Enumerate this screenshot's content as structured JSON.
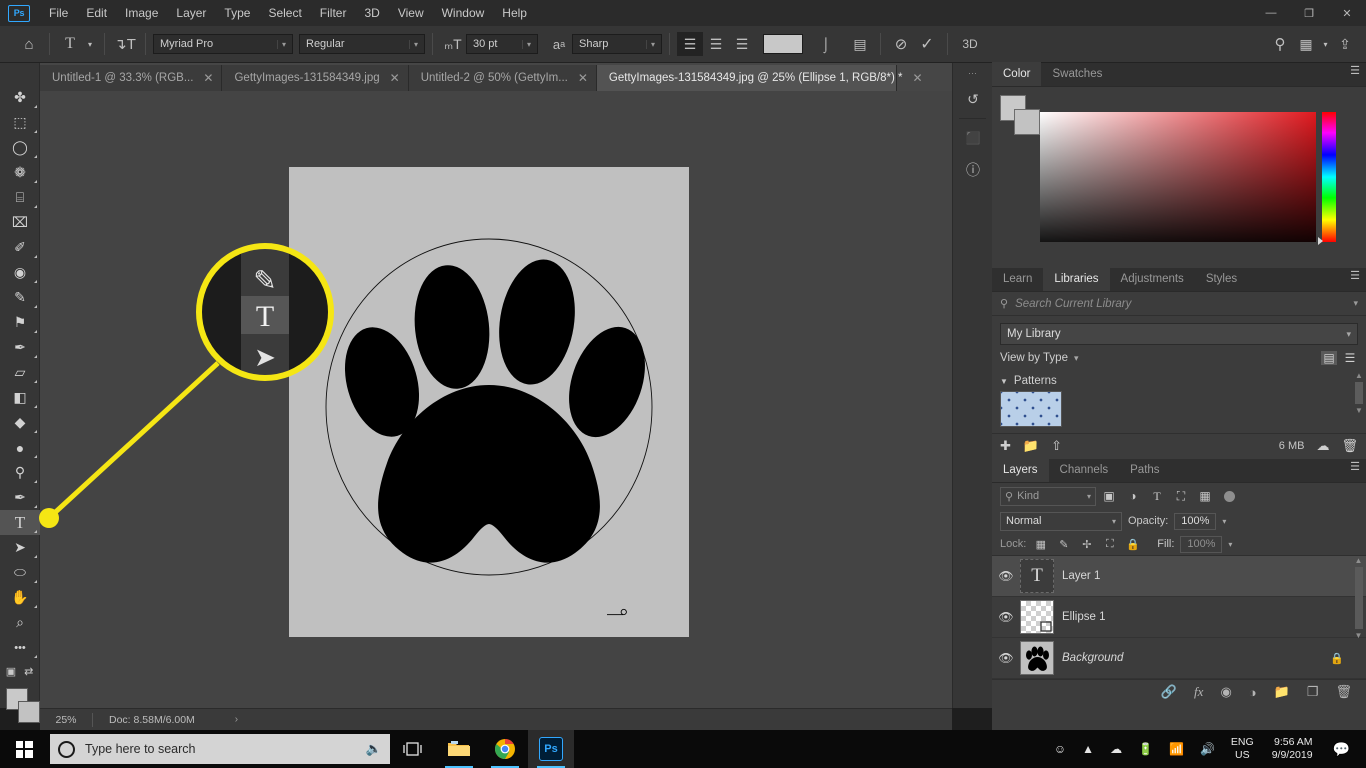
{
  "app": {
    "name": "Adobe Photoshop",
    "logo_text": "Ps"
  },
  "menubar": {
    "items": [
      "File",
      "Edit",
      "Image",
      "Layer",
      "Type",
      "Select",
      "Filter",
      "3D",
      "View",
      "Window",
      "Help"
    ],
    "window_controls": {
      "minimize": "—",
      "restore": "❐",
      "close": "✕"
    }
  },
  "options_bar": {
    "home_icon": "home-icon",
    "tool_preset": "type-tool-icon",
    "orientation_icon": "text-orientation-icon",
    "font_family": "Myriad Pro",
    "font_style": "Regular",
    "size_icon": "font-size-icon",
    "font_size": "30 pt",
    "antialias_icon": "anti-alias-icon",
    "antialias": "Sharp",
    "align_left": "align-left-icon",
    "align_center": "align-center-icon",
    "align_right": "align-right-icon",
    "text_color": "#c8c8c8",
    "warp_icon": "warp-text-icon",
    "panels_icon": "character-panel-icon",
    "cancel_icon": "cancel-edit-icon",
    "commit_icon": "commit-edit-icon",
    "three_d_label": "3D",
    "search_icon": "search-icon",
    "workspace_icon": "workspace-icon",
    "share_icon": "share-icon"
  },
  "tabs": [
    {
      "label": "Untitled-1 @ 33.3% (RGB...",
      "active": false
    },
    {
      "label": "GettyImages-131584349.jpg",
      "active": false
    },
    {
      "label": "Untitled-2 @ 50% (GettyIm...",
      "active": false
    },
    {
      "label": "GettyImages-131584349.jpg @ 25% (Ellipse 1, RGB/8*) *",
      "active": true
    }
  ],
  "toolbar": {
    "tools": [
      {
        "name": "move-tool",
        "glyph": "✤",
        "selected": false,
        "corner": true
      },
      {
        "name": "rectangular-marquee-tool",
        "glyph": "⬚",
        "selected": false,
        "corner": true
      },
      {
        "name": "lasso-tool",
        "glyph": "◯",
        "selected": false,
        "corner": true
      },
      {
        "name": "object-selection-tool",
        "glyph": "❁",
        "selected": false,
        "corner": true
      },
      {
        "name": "crop-tool",
        "glyph": "⌸",
        "selected": false,
        "corner": true
      },
      {
        "name": "frame-tool",
        "glyph": "⌧",
        "selected": false,
        "corner": false
      },
      {
        "name": "eyedropper-tool",
        "glyph": "✐",
        "selected": false,
        "corner": true
      },
      {
        "name": "spot-healing-brush-tool",
        "glyph": "◉",
        "selected": false,
        "corner": true
      },
      {
        "name": "brush-tool",
        "glyph": "✎",
        "selected": false,
        "corner": true
      },
      {
        "name": "clone-stamp-tool",
        "glyph": "⚑",
        "selected": false,
        "corner": true
      },
      {
        "name": "history-brush-tool",
        "glyph": "✒",
        "selected": false,
        "corner": true
      },
      {
        "name": "eraser-tool",
        "glyph": "▱",
        "selected": false,
        "corner": true
      },
      {
        "name": "gradient-tool",
        "glyph": "◧",
        "selected": false,
        "corner": true
      },
      {
        "name": "paint-bucket-tool",
        "glyph": "◆",
        "selected": false,
        "corner": true
      },
      {
        "name": "blur-tool",
        "glyph": "●",
        "selected": false,
        "corner": true
      },
      {
        "name": "dodge-tool",
        "glyph": "⚲",
        "selected": false,
        "corner": true
      },
      {
        "name": "pen-tool",
        "glyph": "✒",
        "selected": false,
        "corner": true
      },
      {
        "name": "type-tool",
        "glyph": "T",
        "selected": true,
        "corner": true
      },
      {
        "name": "path-selection-tool",
        "glyph": "➤",
        "selected": false,
        "corner": true
      },
      {
        "name": "ellipse-tool",
        "glyph": "⬭",
        "selected": false,
        "corner": true
      },
      {
        "name": "hand-tool",
        "glyph": "✋",
        "selected": false,
        "corner": true
      },
      {
        "name": "zoom-tool",
        "glyph": "⌕",
        "selected": false,
        "corner": false
      },
      {
        "name": "edit-toolbar-button",
        "glyph": "•••",
        "selected": false,
        "corner": true
      }
    ],
    "default_colors_icon": "default-colors-icon",
    "swap_colors_icon": "swap-colors-icon",
    "foreground_color": "#c9c9c9",
    "background_color": "#c2c2c2",
    "quick_mask_icon": "quick-mask-icon"
  },
  "callout": {
    "highlight_color": "#f5e614",
    "zoomed_tools": [
      {
        "name": "pen-tool",
        "glyph": "✒"
      },
      {
        "name": "type-tool",
        "glyph": "T"
      },
      {
        "name": "path-selection-tool",
        "glyph": "➤"
      }
    ]
  },
  "canvas": {
    "document_background": "#c0c0c0",
    "artwork": "dog-paw-print",
    "ellipse_path_visible": true,
    "cursor": "text-crosshair-cursor"
  },
  "statusbar": {
    "zoom": "25%",
    "doc_info": "Doc: 8.58M/6.00M",
    "expand_arrow": "›"
  },
  "dock_rail": {
    "items": [
      {
        "name": "history-panel-icon",
        "glyph": "↺"
      },
      {
        "name": "3d-panel-icon",
        "glyph": "⬛"
      },
      {
        "name": "info-panel-icon",
        "glyph": "ⓘ"
      }
    ]
  },
  "color_panel": {
    "tabs": [
      {
        "label": "Color",
        "active": true
      },
      {
        "label": "Swatches",
        "active": false
      }
    ],
    "menu_icon": "panel-menu-icon",
    "foreground": "#c9c9c9",
    "background": "#c2c2c2",
    "ramp_color": "#e0191f"
  },
  "libraries_panel": {
    "tabs": [
      {
        "label": "Learn",
        "active": false
      },
      {
        "label": "Libraries",
        "active": true
      },
      {
        "label": "Adjustments",
        "active": false
      },
      {
        "label": "Styles",
        "active": false
      }
    ],
    "menu_icon": "panel-menu-icon",
    "search_placeholder": "Search Current Library",
    "search_icon": "search-icon",
    "library_name": "My Library",
    "view_by": "View by Type",
    "grid_view_icon": "grid-view-icon",
    "list_view_icon": "list-view-icon",
    "group_label": "Patterns",
    "asset_name": "pattern-thumbnail",
    "size_label": "6 MB",
    "add_icon": "add-content-icon",
    "folder_icon": "new-group-icon",
    "upload_icon": "upload-icon",
    "cloud_icon": "creative-cloud-icon",
    "delete_icon": "delete-icon"
  },
  "layers_panel": {
    "tabs": [
      {
        "label": "Layers",
        "active": true
      },
      {
        "label": "Channels",
        "active": false
      },
      {
        "label": "Paths",
        "active": false
      }
    ],
    "menu_icon": "panel-menu-icon",
    "filter_placeholder": "Kind",
    "filter_icons": [
      "pixel-filter-icon",
      "adjustment-filter-icon",
      "type-filter-icon",
      "shape-filter-icon",
      "smart-object-filter-icon"
    ],
    "filter_toggle": "filter-toggle",
    "blend_mode": "Normal",
    "opacity_label": "Opacity:",
    "opacity_value": "100%",
    "lock_label": "Lock:",
    "lock_icons": [
      "lock-transparent-pixels-icon",
      "lock-image-pixels-icon",
      "lock-position-icon",
      "lock-artboard-nesting-icon",
      "lock-all-icon"
    ],
    "fill_label": "Fill:",
    "fill_value": "100%",
    "layers": [
      {
        "name": "Layer 1",
        "type": "text",
        "visible": true,
        "selected": true,
        "locked": false,
        "thumb_glyph": "T"
      },
      {
        "name": "Ellipse 1",
        "type": "shape",
        "visible": true,
        "selected": false,
        "locked": false,
        "thumb_glyph": ""
      },
      {
        "name": "Background",
        "type": "image",
        "visible": true,
        "selected": false,
        "locked": true,
        "thumb_glyph": ""
      }
    ],
    "footer_icons": [
      "link-layers-icon",
      "layer-style-icon",
      "layer-mask-icon",
      "adjustment-layer-icon",
      "new-group-icon",
      "new-layer-icon",
      "delete-layer-icon"
    ]
  },
  "taskbar": {
    "start_icon": "windows-start-icon",
    "search_placeholder": "Type here to search",
    "cortana_icon": "cortana-circle-icon",
    "mic_icon": "microphone-icon",
    "taskview_icon": "task-view-icon",
    "apps": [
      {
        "name": "file-explorer-icon",
        "open": true
      },
      {
        "name": "google-chrome-icon",
        "open": true
      },
      {
        "name": "photoshop-icon",
        "open": true,
        "active": true
      }
    ],
    "tray": {
      "people_icon": "people-icon",
      "chevron_icon": "show-hidden-icons-icon",
      "onedrive_icon": "onedrive-icon",
      "battery_icon": "battery-icon",
      "wifi_icon": "wifi-icon",
      "volume_icon": "volume-icon",
      "language_line1": "ENG",
      "language_line2": "US",
      "time": "9:56 AM",
      "date": "9/9/2019",
      "action_center_icon": "action-center-icon"
    }
  }
}
